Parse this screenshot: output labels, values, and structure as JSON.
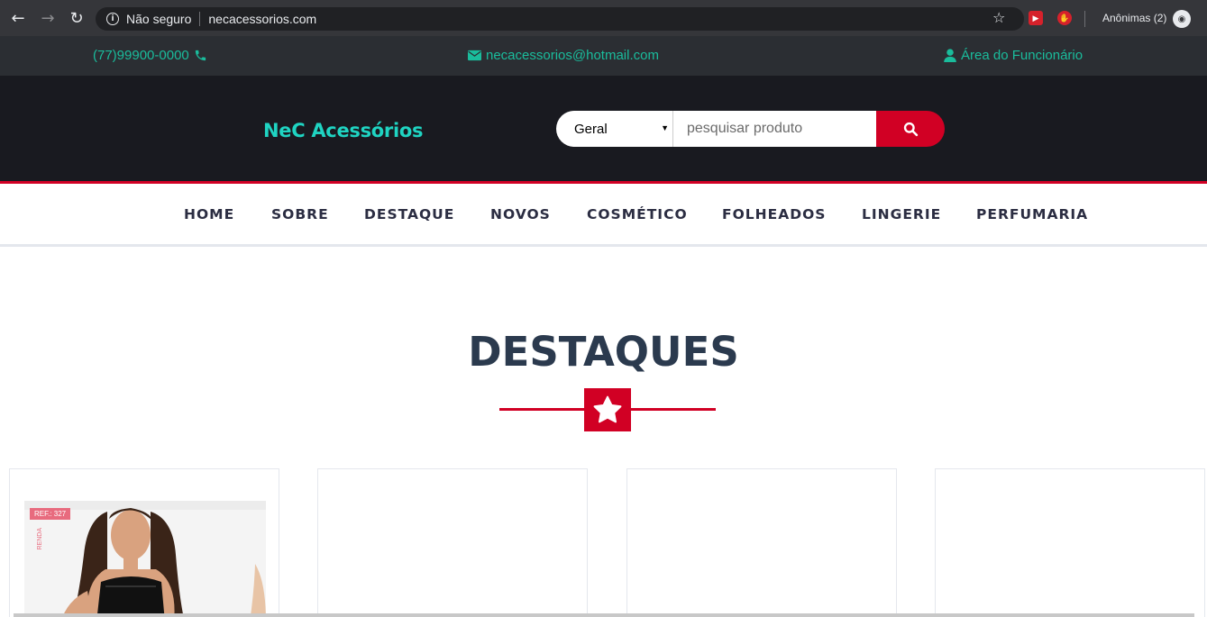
{
  "browser": {
    "security_label": "Não seguro",
    "url": "necacessorios.com",
    "incognito_label": "Anônimas (2)"
  },
  "topbar": {
    "phone": "(77)99900-0000",
    "email": "necacessorios@hotmail.com",
    "employee_area": "Área do Funcionário"
  },
  "header": {
    "brand": "NeC Acessórios",
    "search": {
      "category_selected": "Geral",
      "placeholder": "pesquisar produto"
    }
  },
  "nav": {
    "items": [
      "HOME",
      "SOBRE",
      "DESTAQUE",
      "NOVOS",
      "COSMÉTICO",
      "FOLHEADOS",
      "LINGERIE",
      "PERFUMARIA"
    ]
  },
  "section": {
    "title": "DESTAQUES"
  },
  "products": [
    {
      "ref": "REF.: 327",
      "tag": "RENDA"
    },
    {},
    {},
    {}
  ],
  "colors": {
    "accent": "#d10024",
    "teal": "#1abc9c",
    "header_bg": "#191a20",
    "topbar_bg": "#2b2e33"
  }
}
